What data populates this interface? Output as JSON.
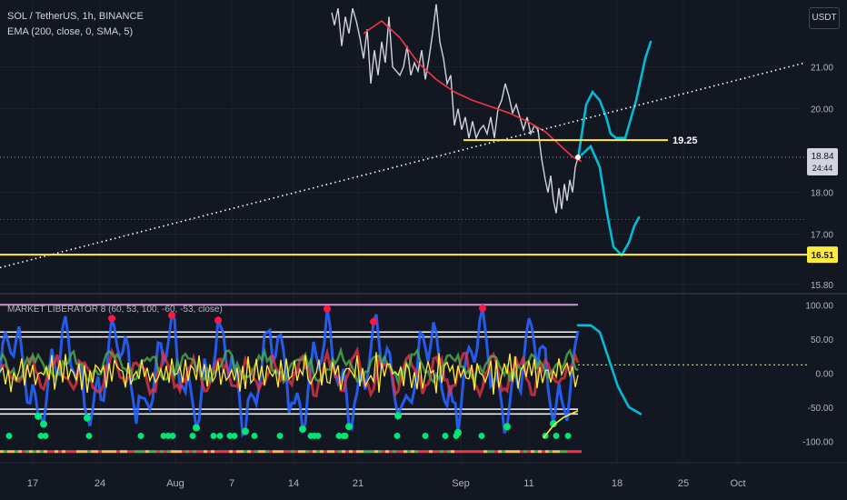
{
  "header": {
    "title": "SOL / TetherUS, 1h, BINANCE",
    "indicator": "EMA (200, close, 0, SMA, 5)",
    "currency": "USDT"
  },
  "oscillator": {
    "label": "MARKET LIBERATOR 8 (60, 53, 100, -60, -53, close)"
  },
  "colors": {
    "background": "#131722",
    "price": "#d1d4dc",
    "ema": "#f23645",
    "forecast": "#00bcd4",
    "level": "#ffeb3b",
    "trendline": "#ffffff",
    "osc_blue": "#2962ff",
    "osc_red": "#f23645",
    "osc_green": "#4caf50",
    "osc_yellow": "#ffeb3b",
    "dot_red": "#ff1744",
    "dot_green": "#00e676"
  },
  "chart_data": [
    {
      "type": "line",
      "panel": "price",
      "title": "SOL / TetherUS, 1h, BINANCE",
      "x_tick_labels": [
        "17",
        "24",
        "Aug",
        "7",
        "14",
        "21",
        "Sep",
        "11",
        "18",
        "25",
        "Oct"
      ],
      "y_ticks": [
        {
          "label": "21.00",
          "value": 21.0
        },
        {
          "label": "20.00",
          "value": 20.0
        },
        {
          "label": "18.00",
          "value": 18.0
        },
        {
          "label": "17.00",
          "value": 17.0
        },
        {
          "label": "15.80",
          "value": 15.8
        }
      ],
      "ylim": [
        15.6,
        22.6
      ],
      "levels": [
        {
          "label": "19.25",
          "value": 19.25
        },
        {
          "label": "16.51",
          "value": 16.51
        }
      ],
      "last_price": {
        "label": "18.84",
        "value": 18.84,
        "countdown": "24:44"
      },
      "series": [
        {
          "kind": "price",
          "points": [
            [
              365,
              22.3
            ],
            [
              368,
              22.0
            ],
            [
              372,
              22.4
            ],
            [
              376,
              21.5
            ],
            [
              380,
              22.2
            ],
            [
              384,
              21.8
            ],
            [
              388,
              22.4
            ],
            [
              392,
              22.1
            ],
            [
              396,
              21.7
            ],
            [
              400,
              21.2
            ],
            [
              404,
              21.9
            ],
            [
              408,
              20.6
            ],
            [
              412,
              21.4
            ],
            [
              416,
              20.8
            ],
            [
              420,
              21.6
            ],
            [
              424,
              21.1
            ],
            [
              428,
              22.2
            ],
            [
              432,
              21.0
            ],
            [
              436,
              20.9
            ],
            [
              440,
              20.8
            ],
            [
              444,
              21.0
            ],
            [
              448,
              21.5
            ],
            [
              452,
              20.8
            ],
            [
              456,
              21.1
            ],
            [
              460,
              20.9
            ],
            [
              464,
              21.4
            ],
            [
              468,
              20.7
            ],
            [
              472,
              21.2
            ],
            [
              476,
              21.8
            ],
            [
              480,
              22.5
            ],
            [
              484,
              21.6
            ],
            [
              488,
              21.2
            ],
            [
              492,
              20.6
            ],
            [
              496,
              20.8
            ],
            [
              500,
              19.6
            ],
            [
              504,
              20.0
            ],
            [
              508,
              19.5
            ],
            [
              512,
              19.8
            ],
            [
              516,
              19.3
            ],
            [
              520,
              19.7
            ],
            [
              524,
              19.3
            ],
            [
              528,
              19.5
            ],
            [
              532,
              19.6
            ],
            [
              536,
              19.4
            ],
            [
              540,
              19.8
            ],
            [
              544,
              19.3
            ],
            [
              548,
              20.0
            ],
            [
              552,
              20.2
            ],
            [
              556,
              20.6
            ],
            [
              560,
              20.3
            ],
            [
              564,
              19.9
            ],
            [
              568,
              20.1
            ],
            [
              572,
              19.8
            ],
            [
              576,
              19.5
            ],
            [
              580,
              19.8
            ],
            [
              584,
              19.4
            ],
            [
              588,
              19.6
            ],
            [
              592,
              19.5
            ],
            [
              596,
              18.8
            ],
            [
              600,
              18.3
            ],
            [
              603,
              18.0
            ],
            [
              606,
              18.4
            ],
            [
              609,
              17.8
            ],
            [
              612,
              17.5
            ],
            [
              615,
              18.1
            ],
            [
              618,
              17.6
            ],
            [
              621,
              18.2
            ],
            [
              624,
              17.8
            ],
            [
              627,
              18.3
            ],
            [
              630,
              18.0
            ],
            [
              633,
              18.6
            ],
            [
              636,
              18.84
            ]
          ]
        },
        {
          "kind": "ema",
          "name": "EMA (200, close, 0, SMA, 5)",
          "points": [
            [
              400,
              21.8
            ],
            [
              420,
              22.1
            ],
            [
              440,
              21.7
            ],
            [
              460,
              21.1
            ],
            [
              480,
              20.7
            ],
            [
              500,
              20.4
            ],
            [
              520,
              20.2
            ],
            [
              540,
              20.05
            ],
            [
              560,
              19.9
            ],
            [
              580,
              19.7
            ],
            [
              600,
              19.45
            ],
            [
              615,
              19.15
            ],
            [
              630,
              18.85
            ],
            [
              640,
              18.74
            ]
          ]
        },
        {
          "kind": "forecast",
          "points": [
            [
              636,
              18.8
            ],
            [
              645,
              20.1
            ],
            [
              652,
              20.4
            ],
            [
              660,
              20.2
            ],
            [
              667,
              19.8
            ],
            [
              672,
              19.4
            ],
            [
              678,
              19.3
            ],
            [
              688,
              19.3
            ],
            [
              700,
              20.2
            ],
            [
              710,
              21.2
            ],
            [
              716,
              21.6
            ]
          ]
        },
        {
          "kind": "forecast",
          "points": [
            [
              640,
              18.9
            ],
            [
              650,
              19.1
            ],
            [
              660,
              18.6
            ],
            [
              668,
              17.5
            ],
            [
              675,
              16.7
            ],
            [
              684,
              16.5
            ],
            [
              692,
              16.8
            ],
            [
              698,
              17.2
            ],
            [
              703,
              17.4
            ]
          ]
        },
        {
          "kind": "trendline",
          "points": [
            [
              0,
              16.2
            ],
            [
              886,
              21.1
            ]
          ]
        }
      ]
    },
    {
      "type": "line",
      "panel": "oscillator",
      "title": "MARKET LIBERATOR 8 (60, 53, 100, -60, -53, close)",
      "y_ticks": [
        {
          "label": "100.00",
          "value": 100
        },
        {
          "label": "50.00",
          "value": 50
        },
        {
          "label": "0.00",
          "value": 0
        },
        {
          "label": "-50.00",
          "value": -50
        },
        {
          "label": "-100.00",
          "value": -100
        }
      ],
      "ylim": [
        -130,
        115
      ],
      "bands": [
        100,
        60,
        53,
        -53,
        -60
      ],
      "series": [
        {
          "kind": "forecast",
          "points": [
            [
              636,
              70
            ],
            [
              650,
              70
            ],
            [
              660,
              60
            ],
            [
              670,
              20
            ],
            [
              680,
              -20
            ],
            [
              692,
              -50
            ],
            [
              705,
              -60
            ]
          ]
        },
        {
          "kind": "trend",
          "points": [
            [
              598,
              -95
            ],
            [
              610,
              -75
            ],
            [
              620,
              -65
            ],
            [
              636,
              -55
            ]
          ]
        }
      ]
    }
  ]
}
